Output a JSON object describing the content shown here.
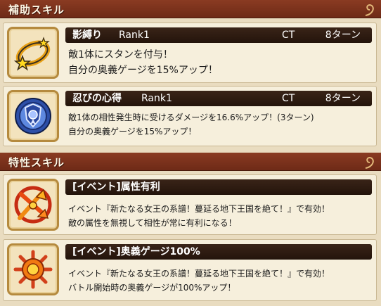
{
  "sections": [
    {
      "title": "補助スキル"
    },
    {
      "title": "特性スキル"
    }
  ],
  "support_skills": [
    {
      "icon": "ring-star-icon",
      "name": "影縛り",
      "rank": "Rank1",
      "ct_label": "CT",
      "ct_value": "8ターン",
      "lines": [
        "敵1体にスタンを付与！",
        "自分の奥義ゲージを15%アップ！"
      ]
    },
    {
      "icon": "blue-shield-icon",
      "name": "忍びの心得",
      "rank": "Rank1",
      "ct_label": "CT",
      "ct_value": "8ターン",
      "lines": [
        "敵1体の相性発生時に受けるダメージを16.6%アップ！(3ターン)",
        "自分の奥義ゲージを15%アップ！"
      ]
    }
  ],
  "trait_skills": [
    {
      "icon": "element-arrow-icon",
      "name": "[イベント]属性有利",
      "lines": [
        "イベント『新たなる女王の系譜！蔓延る地下王国を絶て！』で有効！",
        "敵の属性を無視して相性が常に有利になる！"
      ]
    },
    {
      "icon": "gauge-burst-icon",
      "name": "[イベント]奥義ゲージ100%",
      "lines": [
        "イベント『新たなる女王の系譜！蔓延る地下王国を絶て！』で有効！",
        "バトル開始時の奥義ゲージが100%アップ！"
      ]
    }
  ],
  "colors": {
    "header": "#7a3120",
    "name_bar": "#2c1a10",
    "card_bg": "#f6efdc",
    "icon_border": "#b58a3e"
  }
}
